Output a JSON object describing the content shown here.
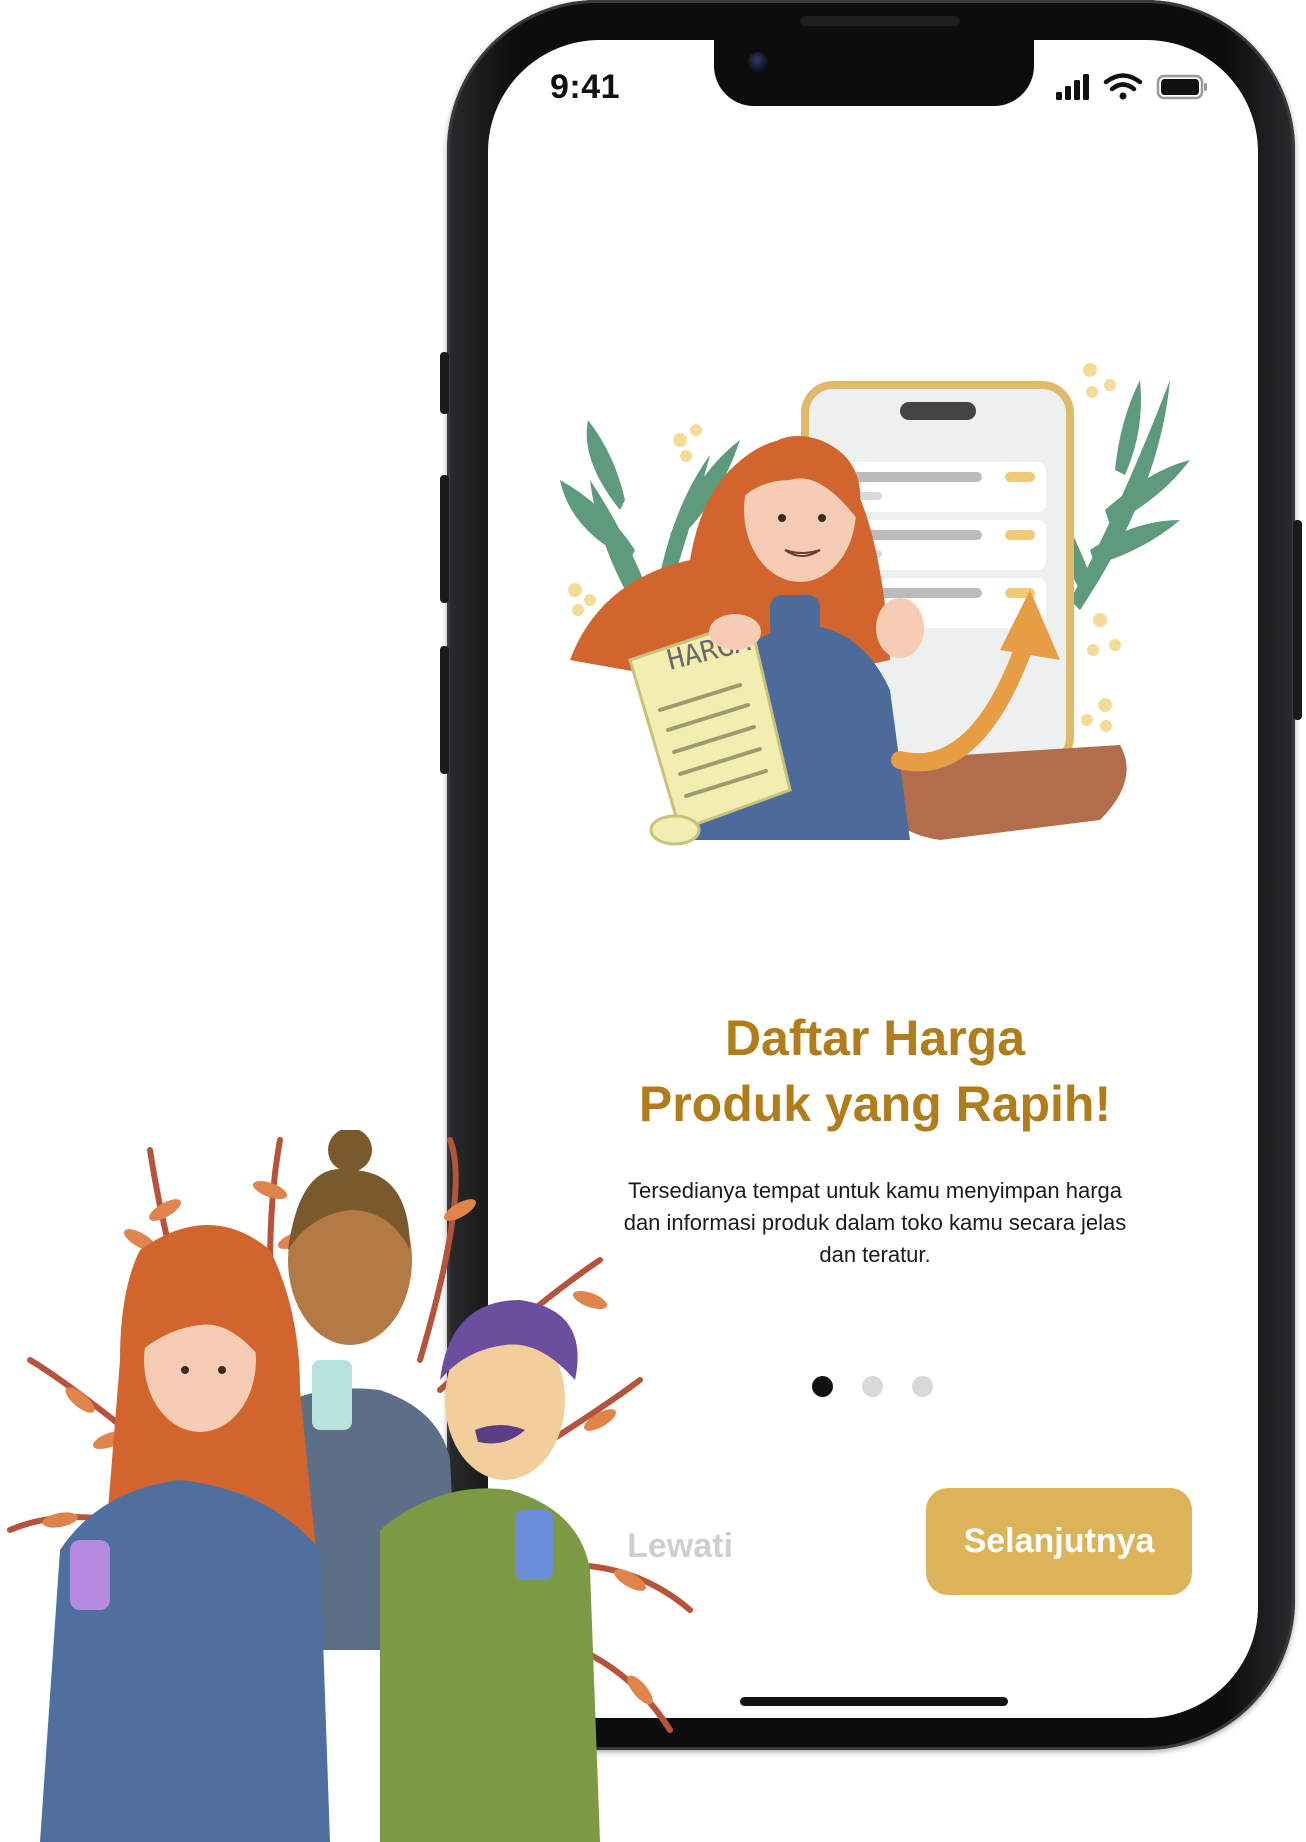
{
  "status_bar": {
    "time": "9:41",
    "icons": [
      "signal-icon",
      "wifi-icon",
      "battery-icon"
    ]
  },
  "illustration": {
    "icon": "price-list-illustration",
    "scroll_label": "HARGA"
  },
  "onboarding": {
    "title_line1": "Daftar Harga",
    "title_line2": "Produk yang Rapih!",
    "description": "Tersedianya tempat untuk kamu menyimpan harga dan informasi produk dalam toko kamu secara jelas dan teratur.",
    "page_indicator": {
      "current": 1,
      "total": 3
    }
  },
  "actions": {
    "skip_label": "Lewati",
    "next_label": "Selanjutnya"
  },
  "decoration": {
    "icon": "people-with-phones-illustration"
  },
  "colors": {
    "accent": "#b07d1a",
    "button": "#ddb35a",
    "dot_active": "#111111",
    "dot_inactive": "#d9d9d9"
  }
}
